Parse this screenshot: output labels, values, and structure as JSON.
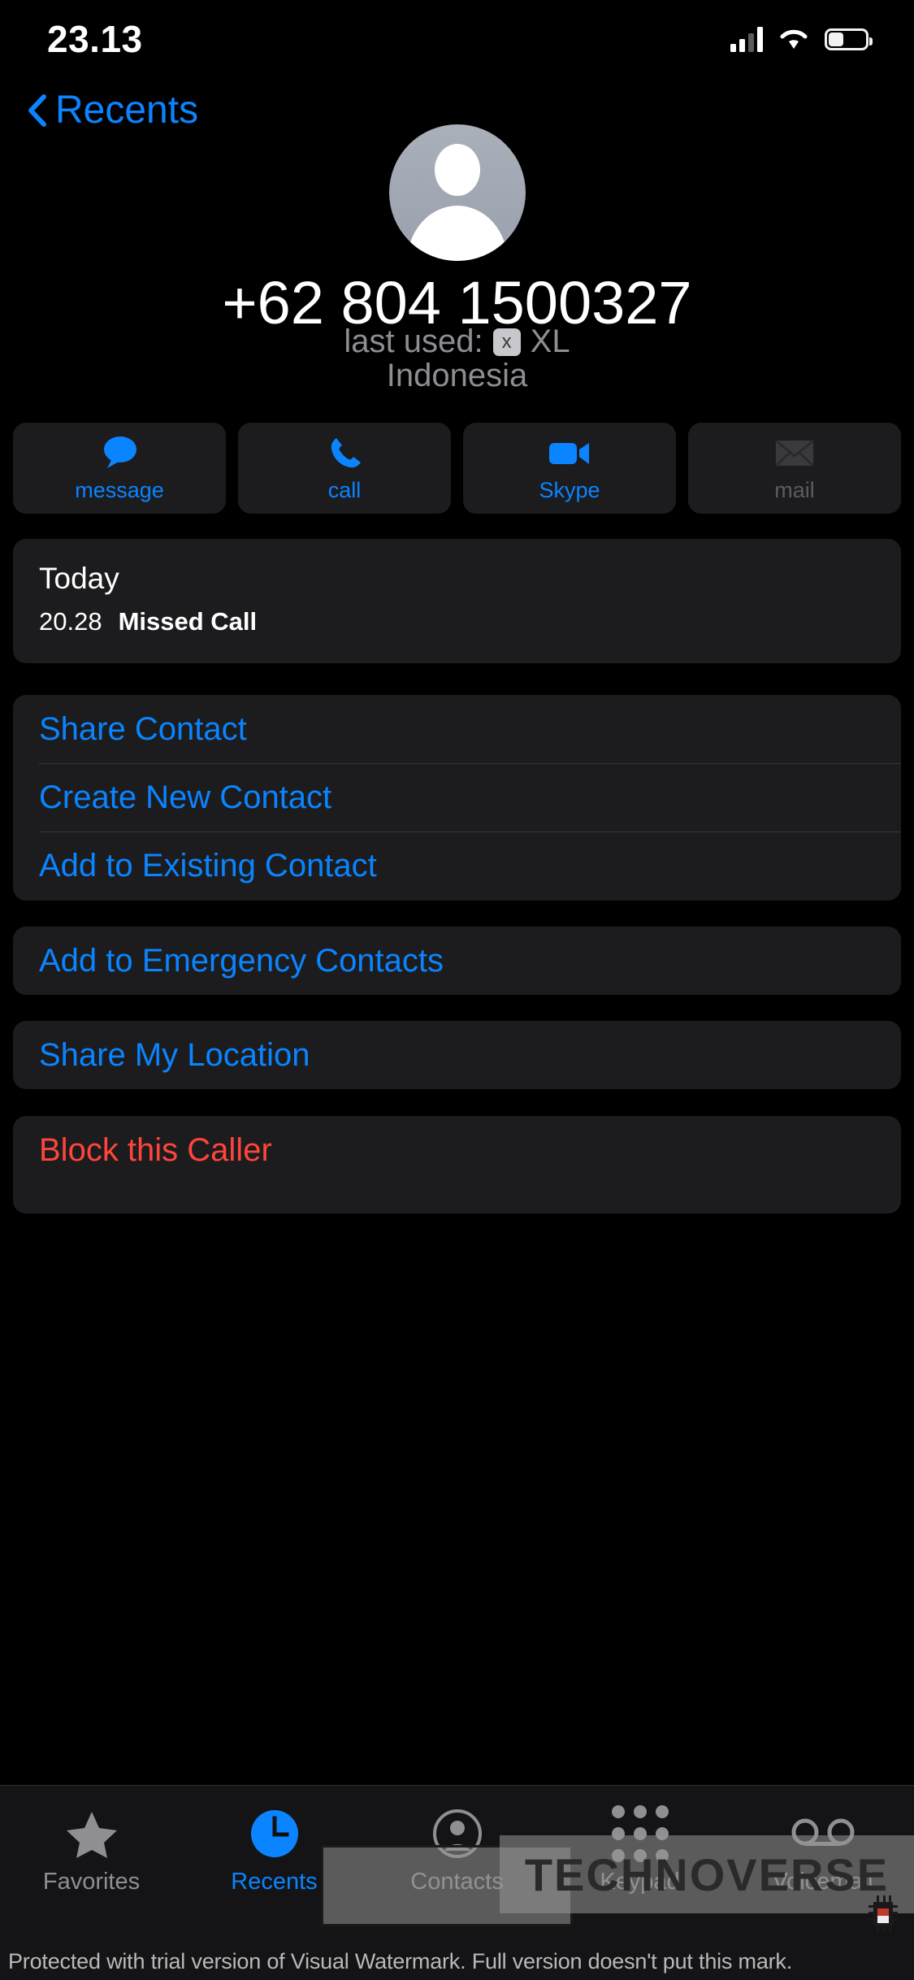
{
  "status_bar": {
    "time": "23.13",
    "signal_icon": "cellular-signal-icon",
    "wifi_icon": "wifi-icon",
    "battery_icon": "battery-icon",
    "battery_level_percent": 38
  },
  "nav": {
    "back_label": "Recents",
    "back_icon": "chevron-left-icon"
  },
  "contact": {
    "avatar_icon": "person-placeholder-avatar",
    "phone_number": "+62 804 1500327",
    "last_used_prefix": "last used:",
    "sim_badge": "x",
    "carrier": "XL",
    "country": "Indonesia"
  },
  "quick_actions": [
    {
      "label": "message",
      "icon": "message-bubble-icon",
      "enabled": true
    },
    {
      "label": "call",
      "icon": "phone-icon",
      "enabled": true
    },
    {
      "label": "Skype",
      "icon": "video-camera-icon",
      "enabled": true
    },
    {
      "label": "mail",
      "icon": "envelope-icon",
      "enabled": false
    }
  ],
  "call_history": {
    "day": "Today",
    "entries": [
      {
        "time": "20.28",
        "type": "Missed Call"
      }
    ]
  },
  "contact_actions": [
    {
      "label": "Share Contact"
    },
    {
      "label": "Create New Contact"
    },
    {
      "label": "Add to Existing Contact"
    }
  ],
  "emergency_actions": [
    {
      "label": "Add to Emergency Contacts"
    }
  ],
  "location_actions": [
    {
      "label": "Share My Location"
    }
  ],
  "block_actions": [
    {
      "label": "Block this Caller"
    }
  ],
  "tab_bar": [
    {
      "label": "Favorites",
      "icon": "star-icon",
      "active": false
    },
    {
      "label": "Recents",
      "icon": "clock-icon",
      "active": true
    },
    {
      "label": "Contacts",
      "icon": "person-circle-icon",
      "active": false
    },
    {
      "label": "Keypad",
      "icon": "keypad-dots-icon",
      "active": false
    },
    {
      "label": "Voicemail",
      "icon": "voicemail-icon",
      "active": false
    }
  ],
  "watermark": {
    "notice": "Protected with trial version of Visual Watermark. Full version doesn't put this mark.",
    "logo_text": "TECHNOVERSE"
  },
  "colors": {
    "accent": "#0a84ff",
    "destructive": "#ff453a",
    "card": "#1c1c1e",
    "secondary_text": "#8e8e93",
    "background": "#000000"
  }
}
